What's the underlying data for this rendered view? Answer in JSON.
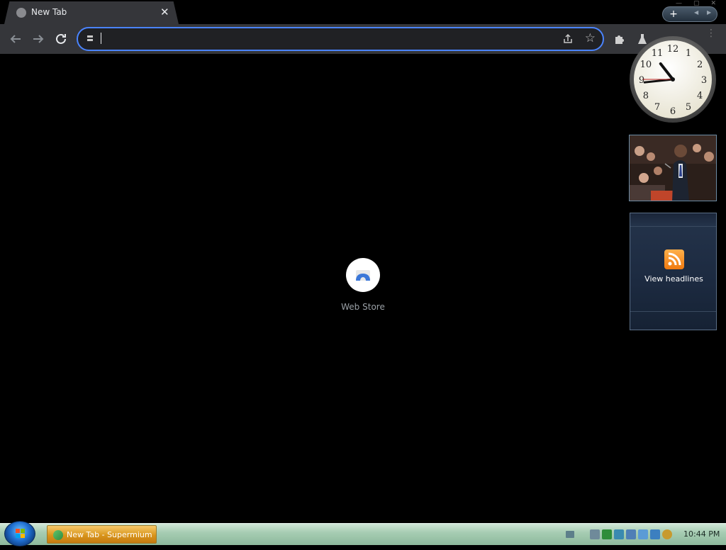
{
  "window": {
    "tab": {
      "title": "New Tab"
    },
    "controls": {
      "minimize": "—",
      "maximize": "▢",
      "close": "✕"
    }
  },
  "toolbar": {
    "back_icon": "arrow-left-icon",
    "forward_icon": "arrow-right-icon",
    "reload_icon": "reload-icon",
    "omnibox": {
      "value": "",
      "placeholder": ""
    }
  },
  "gadget_bar": {
    "add_label": "+",
    "prev_label": "◀",
    "next_label": "▶"
  },
  "new_tab": {
    "shortcuts": [
      {
        "label": "Web Store"
      }
    ]
  },
  "gadgets": {
    "clock": {
      "numbers": [
        "12",
        "1",
        "2",
        "3",
        "4",
        "5",
        "6",
        "7",
        "8",
        "9",
        "10",
        "11"
      ],
      "hour": 10,
      "minute": 44,
      "second": 45
    },
    "feed": {
      "label": "View headlines"
    }
  },
  "taskbar": {
    "active_window": "New Tab - Supermium",
    "time": "10:44 PM"
  },
  "colors": {
    "accent": "#4a84ff",
    "toolbar": "#35363a",
    "omnibox": "#202124",
    "taskbar_task": "#d9951c"
  }
}
